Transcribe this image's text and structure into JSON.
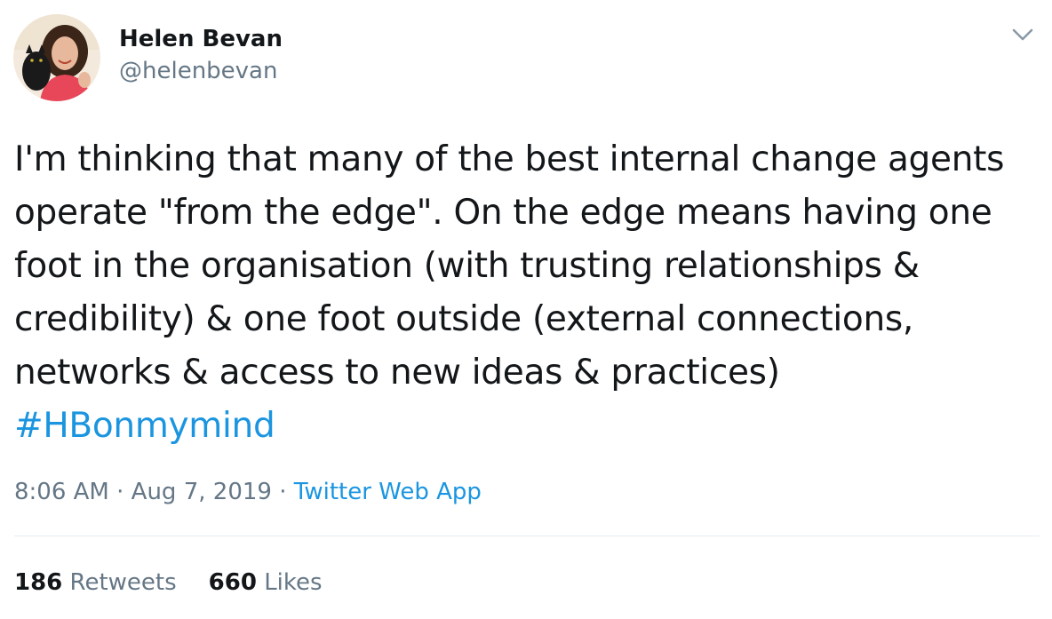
{
  "author": {
    "display_name": "Helen Bevan",
    "handle": "@helenbevan",
    "avatar_icon": "profile-photo"
  },
  "menu": {
    "icon": "chevron-down-icon"
  },
  "tweet": {
    "text": "I'm thinking that many of the best internal change agents operate \"from the edge\". On the edge means having one foot in the organisation (with trusting relationships & credibility) & one foot outside (external connections, networks & access to new ideas & practices) ",
    "hashtag": "#HBonmymind"
  },
  "meta": {
    "time": "8:06 AM",
    "separator": " · ",
    "date": "Aug 7, 2019",
    "source": "Twitter Web App"
  },
  "stats": {
    "retweets_count": "186",
    "retweets_label": "Retweets",
    "likes_count": "660",
    "likes_label": "Likes"
  },
  "colors": {
    "link": "#1b95e0",
    "secondary_text": "#657786",
    "primary_text": "#14171a",
    "divider": "#e6ecf0"
  }
}
